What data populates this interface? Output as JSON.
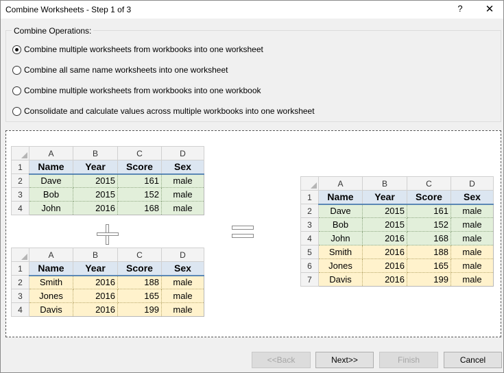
{
  "window": {
    "title": "Combine Worksheets - Step 1 of 3",
    "help_label": "?",
    "close_label": "✕"
  },
  "operations": {
    "group_label": "Combine Operations:",
    "options": [
      {
        "label": "Combine multiple worksheets from workbooks into one worksheet",
        "selected": true
      },
      {
        "label": "Combine all same name worksheets into one worksheet",
        "selected": false
      },
      {
        "label": "Combine multiple worksheets from workbooks into one workbook",
        "selected": false
      },
      {
        "label": "Consolidate and calculate values across multiple workbooks into one worksheet",
        "selected": false
      }
    ]
  },
  "preview": {
    "columns": [
      "A",
      "B",
      "C",
      "D"
    ],
    "headers": [
      "Name",
      "Year",
      "Score",
      "Sex"
    ],
    "table1_rows": [
      {
        "n": "2",
        "cells": [
          "Dave",
          "2015",
          "161",
          "male"
        ]
      },
      {
        "n": "3",
        "cells": [
          "Bob",
          "2015",
          "152",
          "male"
        ]
      },
      {
        "n": "4",
        "cells": [
          "John",
          "2016",
          "168",
          "male"
        ]
      }
    ],
    "table2_rows": [
      {
        "n": "2",
        "cells": [
          "Smith",
          "2016",
          "188",
          "male"
        ]
      },
      {
        "n": "3",
        "cells": [
          "Jones",
          "2016",
          "165",
          "male"
        ]
      },
      {
        "n": "4",
        "cells": [
          "Davis",
          "2016",
          "199",
          "male"
        ]
      }
    ],
    "result_rows": [
      {
        "n": "2",
        "cells": [
          "Dave",
          "2015",
          "161",
          "male"
        ],
        "tint": "green"
      },
      {
        "n": "3",
        "cells": [
          "Bob",
          "2015",
          "152",
          "male"
        ],
        "tint": "green"
      },
      {
        "n": "4",
        "cells": [
          "John",
          "2016",
          "168",
          "male"
        ],
        "tint": "green"
      },
      {
        "n": "5",
        "cells": [
          "Smith",
          "2016",
          "188",
          "male"
        ],
        "tint": "yellow"
      },
      {
        "n": "6",
        "cells": [
          "Jones",
          "2016",
          "165",
          "male"
        ],
        "tint": "yellow"
      },
      {
        "n": "7",
        "cells": [
          "Davis",
          "2016",
          "199",
          "male"
        ],
        "tint": "yellow"
      }
    ],
    "header_row_number": "1",
    "colors": {
      "header_fill": "#dce6f1",
      "green_fill": "#e2efda",
      "yellow_fill": "#fff2cc"
    }
  },
  "buttons": {
    "back": {
      "label": "<<Back",
      "enabled": false
    },
    "next": {
      "label": "Next>>",
      "enabled": true
    },
    "finish": {
      "label": "Finish",
      "enabled": false
    },
    "cancel": {
      "label": "Cancel",
      "enabled": true
    }
  }
}
